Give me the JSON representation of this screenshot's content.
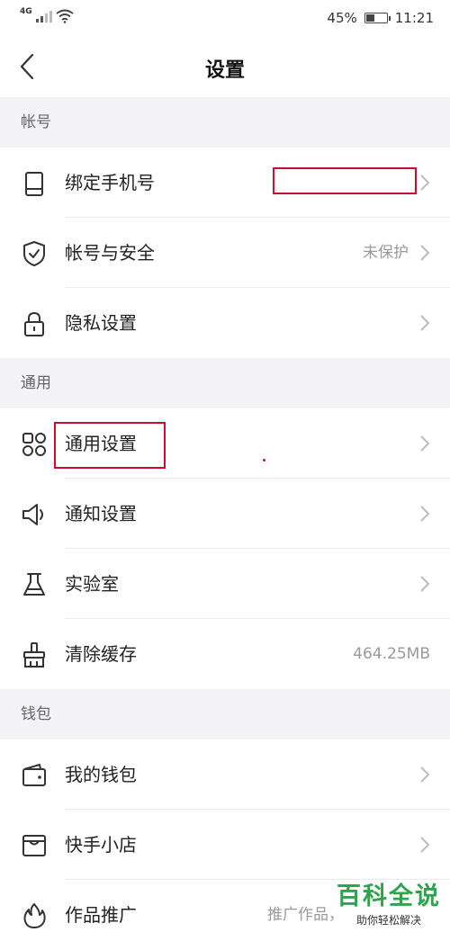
{
  "status_bar": {
    "network": "4G",
    "battery_text": "45%",
    "battery_level": 0.45,
    "time": "11:21"
  },
  "header": {
    "title": "设置"
  },
  "sections": {
    "account": {
      "header": "帐号",
      "items": [
        {
          "label": "绑定手机号",
          "value": "",
          "icon": "phone-icon"
        },
        {
          "label": "帐号与安全",
          "value": "未保护",
          "icon": "shield-icon"
        },
        {
          "label": "隐私设置",
          "value": "",
          "icon": "lock-icon"
        }
      ]
    },
    "general": {
      "header": "通用",
      "items": [
        {
          "label": "通用设置",
          "value": "",
          "icon": "grid-icon"
        },
        {
          "label": "通知设置",
          "value": "",
          "icon": "speaker-icon"
        },
        {
          "label": "实验室",
          "value": "",
          "icon": "flask-icon"
        },
        {
          "label": "清除缓存",
          "value": "464.25MB",
          "icon": "broom-icon"
        }
      ]
    },
    "wallet": {
      "header": "钱包",
      "items": [
        {
          "label": "我的钱包",
          "value": "",
          "icon": "wallet-icon"
        },
        {
          "label": "快手小店",
          "value": "",
          "icon": "store-icon"
        },
        {
          "label": "作品推广",
          "value": "推广作品，",
          "icon": "flame-icon"
        }
      ]
    }
  },
  "watermark": {
    "title": "百科全说",
    "subtitle": "助你轻松解决"
  },
  "colors": {
    "annotation": "#c8102e",
    "watermark_green": "#2ea44f"
  }
}
